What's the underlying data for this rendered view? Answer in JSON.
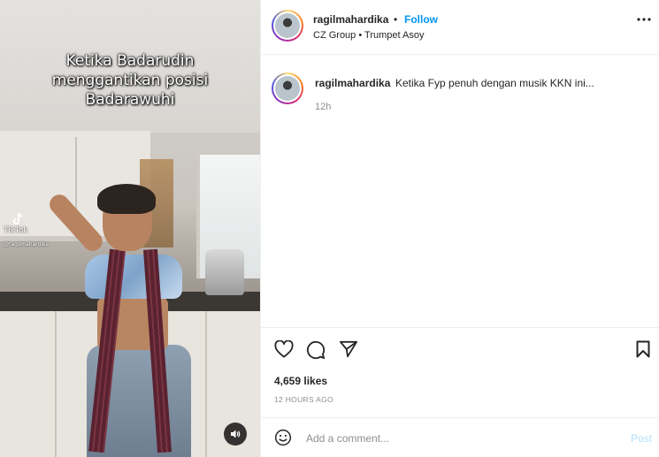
{
  "video": {
    "overlay_lines": [
      "Ketika Badarudin",
      "menggantikan posisi",
      "Badarawuhi"
    ],
    "watermark_brand": "TikTok",
    "watermark_handle": "@ragilmahardika",
    "sound_icon": "speaker-icon"
  },
  "header": {
    "username": "ragilmahardika",
    "separator": "•",
    "follow_label": "Follow",
    "subline": "CZ Group • Trumpet Asoy",
    "more_icon": "more-options-icon"
  },
  "caption": {
    "username": "ragilmahardika",
    "text": "Ketika Fyp penuh dengan musik KKN ini...",
    "time": "12h"
  },
  "actions": {
    "likes": "4,659 likes",
    "posted_ago": "12 HOURS AGO"
  },
  "comment": {
    "placeholder": "Add a comment...",
    "post_label": "Post"
  },
  "colors": {
    "follow": "#0095f6",
    "post_disabled": "#b3dffc",
    "muted_text": "#8e8e8e",
    "divider": "#efefef"
  }
}
